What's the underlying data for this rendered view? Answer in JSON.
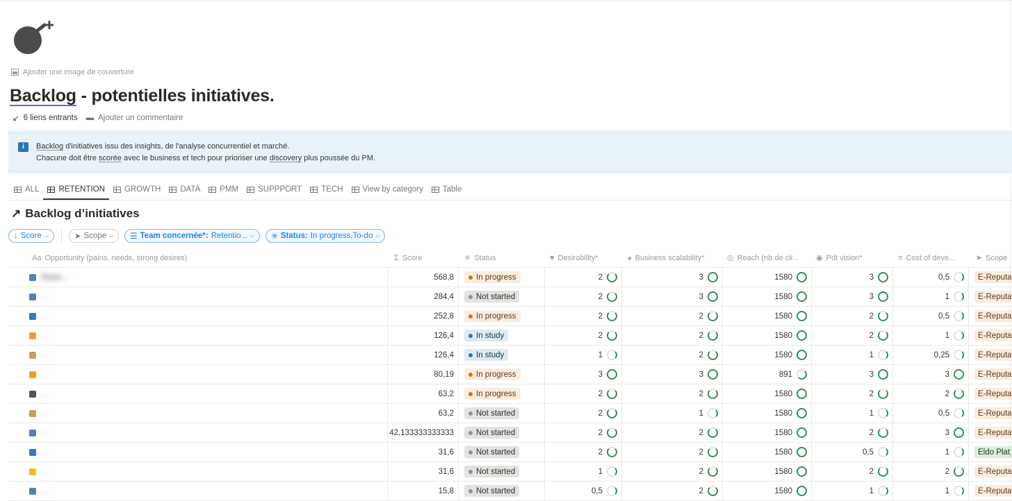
{
  "page": {
    "add_cover": "Ajouter une image de couverture",
    "title_part1": "Backlog",
    "title_part2": " - potentielles initiatives.",
    "backlinks": "6 liens entrants",
    "add_comment": "Ajouter un commentaire"
  },
  "callout": {
    "l1_a": "Backlog",
    "l1_b": " d'initiatives issu des insights, de l'analyse concurrentiel et marché.",
    "l2_a": "Chacune doit être ",
    "l2_b": "scorée",
    "l2_c": " avec le business et tech pour prioriser une ",
    "l2_d": "discovery",
    "l2_e": " plus poussée du PM."
  },
  "tabs": [
    "ALL",
    "RETENTION",
    "GROWTH",
    "DATA",
    "PMM",
    "SUPPPORT",
    "TECH",
    "View by category",
    "Table"
  ],
  "db_title": "Backlog d’initiatives",
  "filters": {
    "score": "Score",
    "scope": "Scope",
    "team_label": "Team concernée*:",
    "team_value": "Retentio...",
    "status_label": "Status:",
    "status_value": "In progress,To-do"
  },
  "columns": {
    "opportunity": "Opportunity (pains, needs, strong desires)",
    "score": "Score",
    "status": "Status",
    "desirability": "Desirability*",
    "scalability": "Business scalability*",
    "reach": "Reach (nb de cli...",
    "vision": "Pdt vision*",
    "cost": "Cost of deve...",
    "scope": "Scope"
  },
  "rows": [
    {
      "name": "Share...",
      "score": "568,8",
      "status": "In progress",
      "des": "2",
      "bus": "3",
      "reach": "1580",
      "vision": "3",
      "cost": "0,5",
      "scope": "E-Reputa"
    },
    {
      "name": "...",
      "score": "284,4",
      "status": "Not started",
      "des": "2",
      "bus": "3",
      "reach": "1580",
      "vision": "3",
      "cost": "1",
      "scope": "E-Reputa"
    },
    {
      "name": "...",
      "score": "252,8",
      "status": "In progress",
      "des": "2",
      "bus": "2",
      "reach": "1580",
      "vision": "2",
      "cost": "0,5",
      "scope": "E-Reputa"
    },
    {
      "name": "...",
      "score": "126,4",
      "status": "In study",
      "des": "2",
      "bus": "2",
      "reach": "1580",
      "vision": "2",
      "cost": "1",
      "scope": "E-Reputa"
    },
    {
      "name": "...",
      "score": "126,4",
      "status": "In study",
      "des": "1",
      "bus": "2",
      "reach": "1580",
      "vision": "1",
      "cost": "0,25",
      "scope": "E-Reputa"
    },
    {
      "name": "...",
      "score": "80,19",
      "status": "In progress",
      "des": "3",
      "bus": "3",
      "reach": "891",
      "vision": "3",
      "cost": "3",
      "scope": "E-Reputa"
    },
    {
      "name": "...",
      "score": "63,2",
      "status": "In progress",
      "des": "2",
      "bus": "2",
      "reach": "1580",
      "vision": "2",
      "cost": "2",
      "scope": "E-Reputa"
    },
    {
      "name": "...",
      "score": "63,2",
      "status": "Not started",
      "des": "2",
      "bus": "1",
      "reach": "1580",
      "vision": "1",
      "cost": "0,5",
      "scope": "E-Reputa"
    },
    {
      "name": "...",
      "score": "42,133333333333",
      "status": "Not started",
      "des": "2",
      "bus": "2",
      "reach": "1580",
      "vision": "2",
      "cost": "3",
      "scope": "E-Reputa"
    },
    {
      "name": "...",
      "score": "31,6",
      "status": "Not started",
      "des": "2",
      "bus": "2",
      "reach": "1580",
      "vision": "0,5",
      "cost": "1",
      "scope": "Eldo Plat"
    },
    {
      "name": "...",
      "score": "31,6",
      "status": "Not started",
      "des": "1",
      "bus": "2",
      "reach": "1580",
      "vision": "2",
      "cost": "2",
      "scope": "E-Reputa"
    },
    {
      "name": "...",
      "score": "15,8",
      "status": "Not started",
      "des": "0,5",
      "bus": "2",
      "reach": "1580",
      "vision": "1",
      "cost": "1",
      "scope": "E-Reputa"
    }
  ],
  "icons": {
    "page_icon": "bomb-icon",
    "row_icons": [
      "chart-icon",
      "chart-icon",
      "phone-icon",
      "memo-icon",
      "pencil-icon",
      "star-icon",
      "gear-icon",
      "pencil-icon",
      "chart-icon",
      "phone-icon",
      "grin-icon",
      "chart-icon"
    ],
    "row_icon_colors": [
      "#5b7db5",
      "#5b7db5",
      "#3f6fd1",
      "#e0a23b",
      "#c0a060",
      "#f0a020",
      "#555555",
      "#c0a060",
      "#5b7db5",
      "#3f6fd1",
      "#f0c020",
      "#5b7db5"
    ]
  }
}
